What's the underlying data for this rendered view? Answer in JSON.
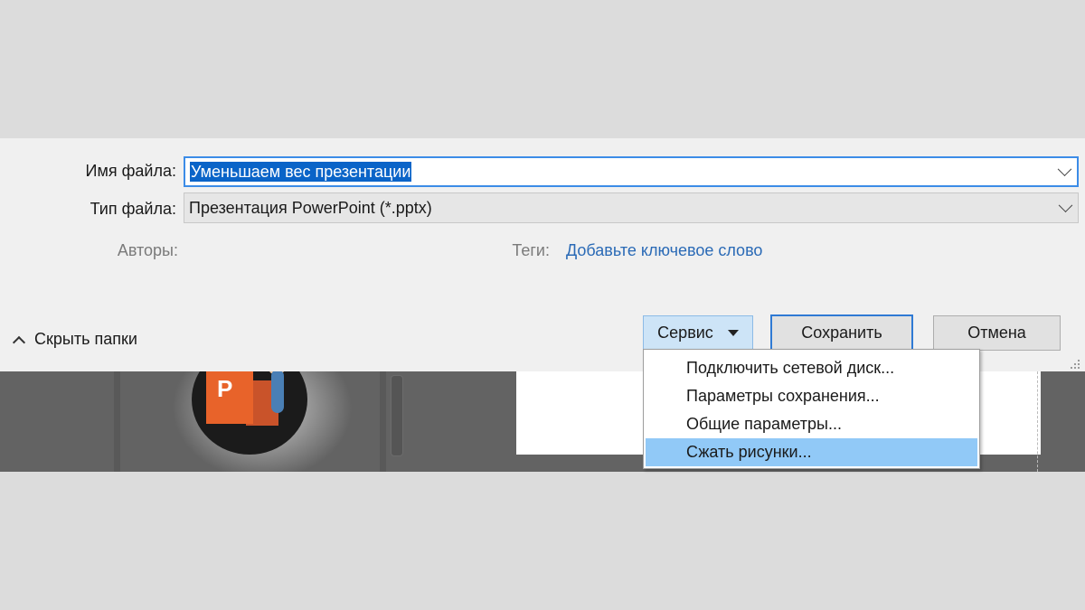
{
  "dialog": {
    "file_name_label": "Имя файла:",
    "file_name_value": "Уменьшаем вес презентации",
    "file_type_label": "Тип файла:",
    "file_type_value": "Презентация PowerPoint (*.pptx)",
    "authors_label": "Авторы:",
    "tags_label": "Теги:",
    "tags_link": "Добавьте ключевое слово",
    "hide_folders_label": "Скрыть папки"
  },
  "buttons": {
    "service": "Сервис",
    "save": "Сохранить",
    "cancel": "Отмена"
  },
  "menu": {
    "items": [
      {
        "label": "Подключить сетевой диск..."
      },
      {
        "label": "Параметры сохранения..."
      },
      {
        "label": "Общие параметры..."
      },
      {
        "label": "Сжать рисунки..."
      }
    ],
    "highlighted_index": 3
  },
  "thumbnail": {
    "logo_letter": "P"
  },
  "colors": {
    "selection": "#0a64c8",
    "link": "#2a6ab6",
    "highlight": "#91c9f7",
    "ppt_orange": "#e8632a"
  }
}
